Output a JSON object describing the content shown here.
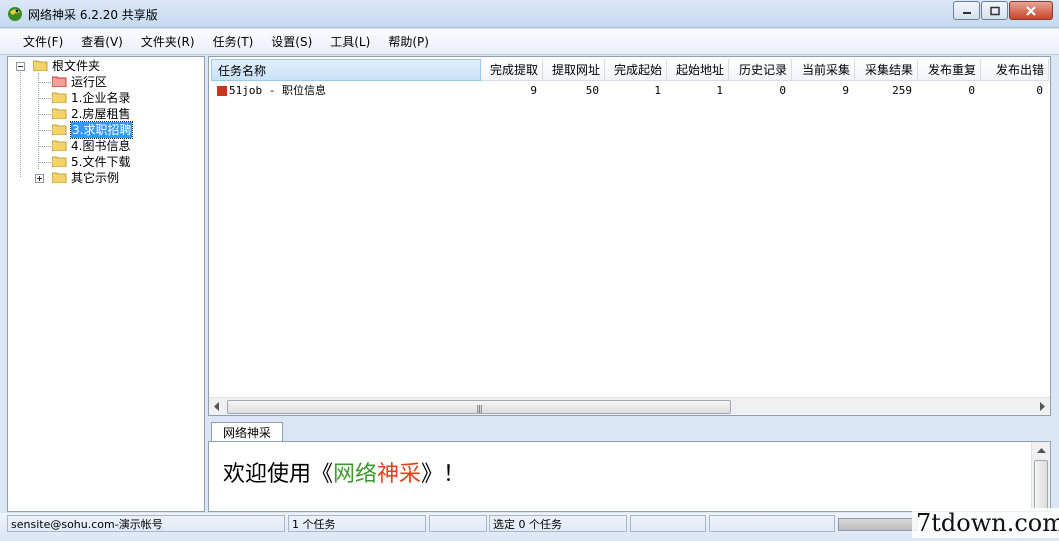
{
  "window": {
    "title": "网络神采 6.2.20 共享版"
  },
  "menu": [
    "文件(F)",
    "查看(V)",
    "文件夹(R)",
    "任务(T)",
    "设置(S)",
    "工具(L)",
    "帮助(P)"
  ],
  "tree": {
    "root": "根文件夹",
    "items": [
      "运行区",
      "1.企业名录",
      "2.房屋租售",
      "3.求职招聘",
      "4.图书信息",
      "5.文件下载",
      "其它示例"
    ],
    "selected": "3.求职招聘"
  },
  "task_list": {
    "columns": [
      "任务名称",
      "完成提取",
      "提取网址",
      "完成起始",
      "起始地址",
      "历史记录",
      "当前采集",
      "采集结果",
      "发布重复",
      "发布出错"
    ],
    "rows": [
      [
        "51job - 职位信息",
        "9",
        "50",
        "1",
        "1",
        "0",
        "9",
        "259",
        "0",
        "0"
      ]
    ]
  },
  "bottom": {
    "tab": "网络神采",
    "welcome_prefix": "欢迎使用《",
    "welcome_word1": "网络",
    "welcome_word2": "神采",
    "welcome_suffix": "》！",
    "colors": {
      "word1": "#3a9a2a",
      "word2": "#e0401a"
    }
  },
  "status": {
    "account": "sensite@sohu.com-演示帐号",
    "task_count": "1 个任务",
    "selected": "选定 0 个任务"
  },
  "watermark": "7tdown.com"
}
